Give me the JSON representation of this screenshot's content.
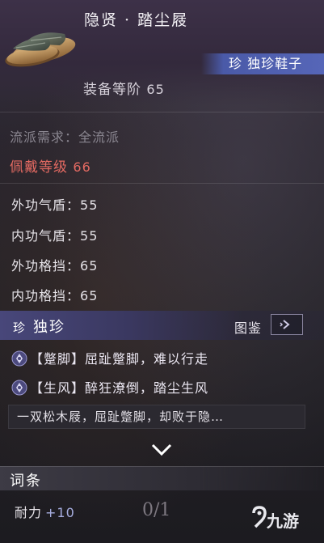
{
  "item": {
    "title": "隐贤 · 踏尘屐",
    "icon": "sandals-icon",
    "rarity_label": "珍 独珍鞋子",
    "gear_level_label": "装备等阶",
    "gear_level": "65"
  },
  "requirements": {
    "school": "流派需求：全流派",
    "wear_level_label": "佩戴等级",
    "wear_level": "66"
  },
  "stats": [
    {
      "label": "外功气盾：",
      "value": "55"
    },
    {
      "label": "内功气盾：",
      "value": "55"
    },
    {
      "label": "外功格挡：",
      "value": "65"
    },
    {
      "label": "内功格挡：",
      "value": "65"
    }
  ],
  "rare_section": {
    "mark": "珍",
    "label": "独珍",
    "codex_label": "图鉴",
    "codex_icon": "arrow-right-icon"
  },
  "effects": [
    {
      "text": "【蹩脚】屈趾蹩脚，难以行走"
    },
    {
      "text": "【生风】醉狂潦倒，踏尘生风"
    }
  ],
  "flavor_text": "一双松木屐，屈趾蹩脚，却败于隐…",
  "expand_icon": "chevron-down-icon",
  "entries": {
    "title": "词条",
    "durability_label": "耐力",
    "durability_bonus": "+10",
    "slot_count": "0/1"
  },
  "watermark": "九游",
  "colors": {
    "rarity_blue": "#5666b8",
    "requirement_red": "#e46a62",
    "bonus_blue": "#a7aee0"
  }
}
